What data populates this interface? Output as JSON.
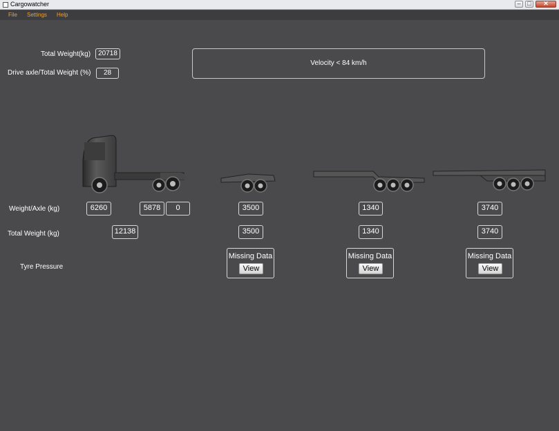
{
  "window": {
    "title": "Cargowatcher"
  },
  "menu": [
    "File",
    "Settings",
    "Help"
  ],
  "summary": {
    "total_weight_label": "Total Weight(kg)",
    "total_weight_value": "20718",
    "drive_axle_label": "Drive axle/Total Weight (%)",
    "drive_axle_value": "28"
  },
  "velocity": {
    "text": "Velocity < 84 km/h"
  },
  "rows": {
    "weight_axle_label": "Weight/Axle (kg)",
    "total_weight_label": "Total Weight (kg)",
    "tyre_pressure_label": "Tyre Pressure"
  },
  "truck": {
    "axles": [
      "6260",
      "5878",
      "0"
    ],
    "total": "12138"
  },
  "units": [
    {
      "axle": "3500",
      "total": "3500",
      "tyre_status": "Missing Data",
      "view_label": "View"
    },
    {
      "axle": "1340",
      "total": "1340",
      "tyre_status": "Missing Data",
      "view_label": "View"
    },
    {
      "axle": "3740",
      "total": "3740",
      "tyre_status": "Missing Data",
      "view_label": "View"
    }
  ],
  "colors": {
    "background": "#4a4a4d",
    "menu_text": "#f0a030",
    "border": "#d8d8d8"
  },
  "icons": {
    "app": "app-window-icon",
    "truck": "truck-tractor-icon",
    "dolly": "dolly-icon",
    "trailer": "flatbed-trailer-icon"
  }
}
